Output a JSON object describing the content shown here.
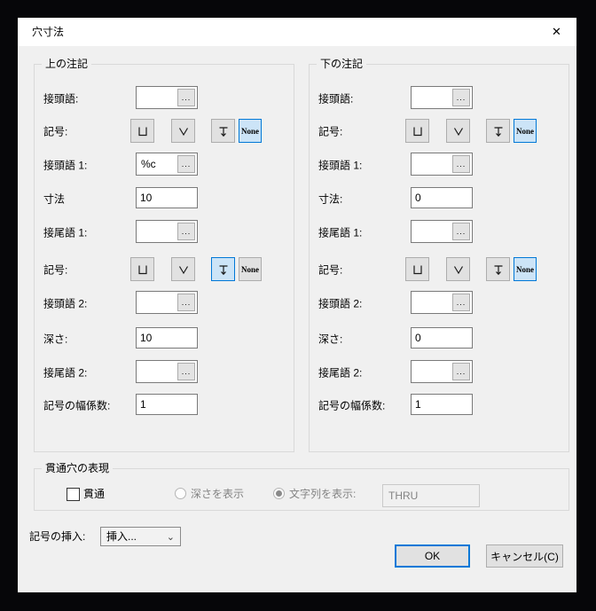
{
  "window": {
    "title": "穴寸法"
  },
  "icons": {
    "close": "✕",
    "ellipsis": "...",
    "chevron_down": "⌄"
  },
  "colors": {
    "accent": "#0078d7",
    "selected_bg": "#cce4f7",
    "disabled_text": "#838383",
    "dialog_bg": "#f0f0f0",
    "titlebar_bg": "#ffffff"
  },
  "panels": [
    {
      "title": "上の注記",
      "prefix_label": "接頭語:",
      "prefix_value": "",
      "symbol1_label": "記号:",
      "symbol1_selected": "none",
      "prefix1_label": "接頭語 1:",
      "prefix1_value": "%c",
      "dim_label": "寸法",
      "dim_value": "10",
      "suffix1_label": "接尾語 1:",
      "suffix1_value": "",
      "symbol2_label": "記号:",
      "symbol2_selected": "depth",
      "prefix2_label": "接頭語 2:",
      "prefix2_value": "",
      "depth_label": "深さ:",
      "depth_value": "10",
      "suffix2_label": "接尾語 2:",
      "suffix2_value": "",
      "width_factor_label": "記号の幅係数:",
      "width_factor_value": "1",
      "none_label": "None"
    },
    {
      "title": "下の注記",
      "prefix_label": "接頭語:",
      "prefix_value": "",
      "symbol1_label": "記号:",
      "symbol1_selected": "none",
      "prefix1_label": "接頭語 1:",
      "prefix1_value": "",
      "dim_label": "寸法:",
      "dim_value": "0",
      "suffix1_label": "接尾語 1:",
      "suffix1_value": "",
      "symbol2_label": "記号:",
      "symbol2_selected": "none",
      "prefix2_label": "接頭語 2:",
      "prefix2_value": "",
      "depth_label": "深さ:",
      "depth_value": "0",
      "suffix2_label": "接尾語 2:",
      "suffix2_value": "",
      "width_factor_label": "記号の幅係数:",
      "width_factor_value": "1",
      "none_label": "None"
    }
  ],
  "through_group": {
    "title": "貫通穴の表現",
    "checkbox_label": "貫通",
    "checkbox_checked": false,
    "radio_depth_label": "深さを表示",
    "radio_text_label": "文字列を表示:",
    "radio_selected": "text",
    "text_value": "THRU"
  },
  "footer": {
    "insert_label": "記号の挿入:",
    "insert_dropdown_value": "挿入...",
    "ok_label": "OK",
    "cancel_label": "キャンセル(C)"
  }
}
